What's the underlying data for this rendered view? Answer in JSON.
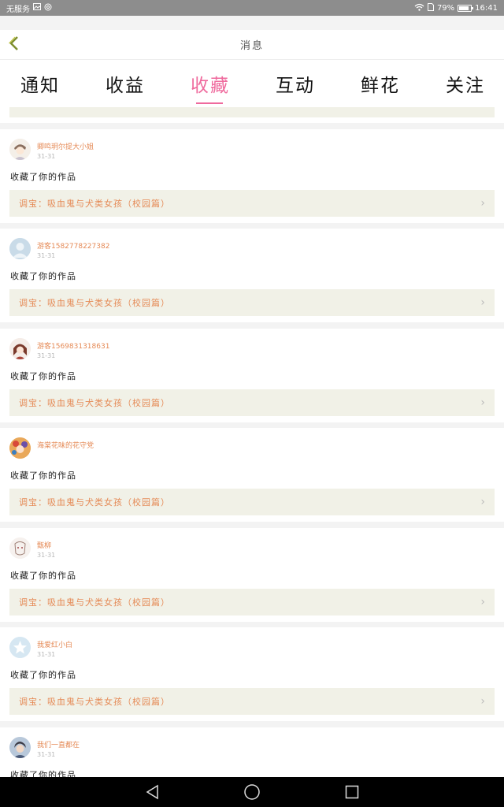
{
  "status_bar": {
    "carrier": "无服务",
    "battery": "79%",
    "time": "16:41"
  },
  "header": {
    "title": "消息"
  },
  "tabs": [
    {
      "label": "通知"
    },
    {
      "label": "收益"
    },
    {
      "label": "收藏",
      "active": true
    },
    {
      "label": "互动"
    },
    {
      "label": "鲜花"
    },
    {
      "label": "关注"
    }
  ],
  "accent_color": "#ef6a9d",
  "name_color": "#e58a56",
  "messages": [
    {
      "user": "卿鸣玥尔提大小姐",
      "date": "31-31",
      "action": "收藏了你的作品",
      "work": "调宝：吸血鬼与犬类女孩（校园篇）",
      "avatar": "anime-boy-avatar"
    },
    {
      "user": "游客15827782273​82",
      "date": "31-31",
      "action": "收藏了你的作品",
      "work": "调宝：吸血鬼与犬类女孩（校园篇）",
      "avatar": "default-user-avatar"
    },
    {
      "user": "游客15698313​18631",
      "date": "31-31",
      "action": "收藏了你的作品",
      "work": "调宝：吸血鬼与犬类女孩（校园篇）",
      "avatar": "anime-girl-avatar"
    },
    {
      "user": "海棠花味的花守党",
      "date": "",
      "action": "收藏了你的作品",
      "work": "调宝：吸血鬼与犬类女孩（校园篇）",
      "avatar": "colorful-avatar"
    },
    {
      "user": "甄柳",
      "date": "31-31",
      "action": "收藏了你的作品",
      "work": "调宝：吸血鬼与犬类女孩（校园篇）",
      "avatar": "sketch-avatar"
    },
    {
      "user": "我爱红小白",
      "date": "31-31",
      "action": "收藏了你的作品",
      "work": "调宝：吸血鬼与犬类女孩（校园篇）",
      "avatar": "star-avatar"
    },
    {
      "user": "我们一直都在",
      "date": "31-31",
      "action": "收藏了你的作品",
      "work": "",
      "avatar": "photo-avatar"
    }
  ]
}
